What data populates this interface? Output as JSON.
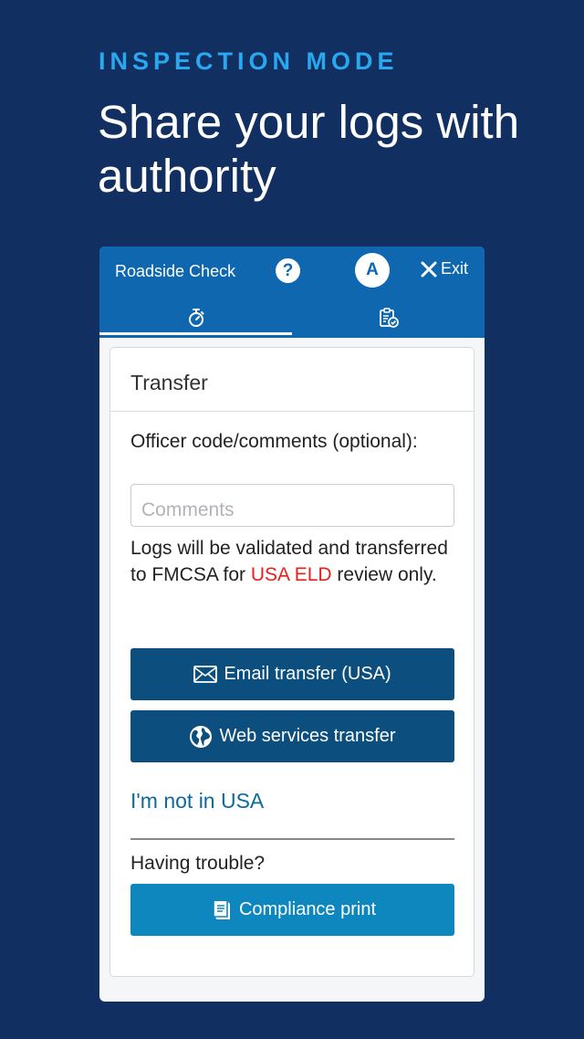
{
  "promo": {
    "eyebrow": "INSPECTION MODE",
    "headline": "Share your logs with authority"
  },
  "header": {
    "title": "Roadside Check",
    "help_icon": "question-circle-icon",
    "avatar_letter": "A",
    "exit_label": "Exit"
  },
  "tabs": [
    {
      "icon": "stopwatch-icon",
      "active": true
    },
    {
      "icon": "clipboard-check-icon",
      "active": false
    }
  ],
  "transfer": {
    "title": "Transfer",
    "officer_label": "Officer code/comments (optional):",
    "comments_placeholder": "Comments",
    "note_part1": "Logs will be validated and transferred to FMCSA for ",
    "note_highlight": "USA ELD",
    "note_part2": " review only.",
    "email_button": "Email transfer (USA)",
    "web_button": "Web services transfer",
    "not_usa_link": "I'm not in USA",
    "trouble_label": "Having trouble?",
    "print_button": "Compliance print"
  },
  "colors": {
    "background": "#112f60",
    "eyebrow": "#29a8f0",
    "header": "#0f67b0",
    "primary_button": "#0c4f7e",
    "secondary_button": "#0e87bf",
    "highlight": "#e8201c",
    "link": "#0f6a9b"
  }
}
